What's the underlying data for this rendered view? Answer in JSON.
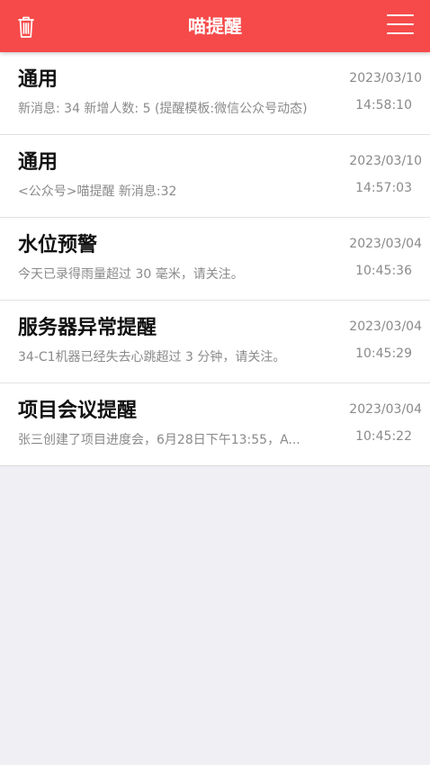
{
  "header": {
    "title": "喵提醒",
    "left_icon": "trash-icon",
    "right_icon": "menu-icon",
    "background_color": "#f64a4a"
  },
  "messages": [
    {
      "title": "通用",
      "preview": "新消息: 34 新增人数: 5 (提醒模板:微信公众号动态)",
      "date": "2023/03/10",
      "time": "14:58:10"
    },
    {
      "title": "通用",
      "preview": "<公众号>喵提醒 新消息:32",
      "date": "2023/03/10",
      "time": "14:57:03"
    },
    {
      "title": "水位预警",
      "preview": "今天已录得雨量超过 30 毫米，请关注。",
      "date": "2023/03/04",
      "time": "10:45:36"
    },
    {
      "title": "服务器异常提醒",
      "preview": "34-C1机器已经失去心跳超过 3 分钟，请关注。",
      "date": "2023/03/04",
      "time": "10:45:29"
    },
    {
      "title": "项目会议提醒",
      "preview": "张三创建了项目进度会，6月28日下午13:55，A...",
      "date": "2023/03/04",
      "time": "10:45:22"
    }
  ]
}
